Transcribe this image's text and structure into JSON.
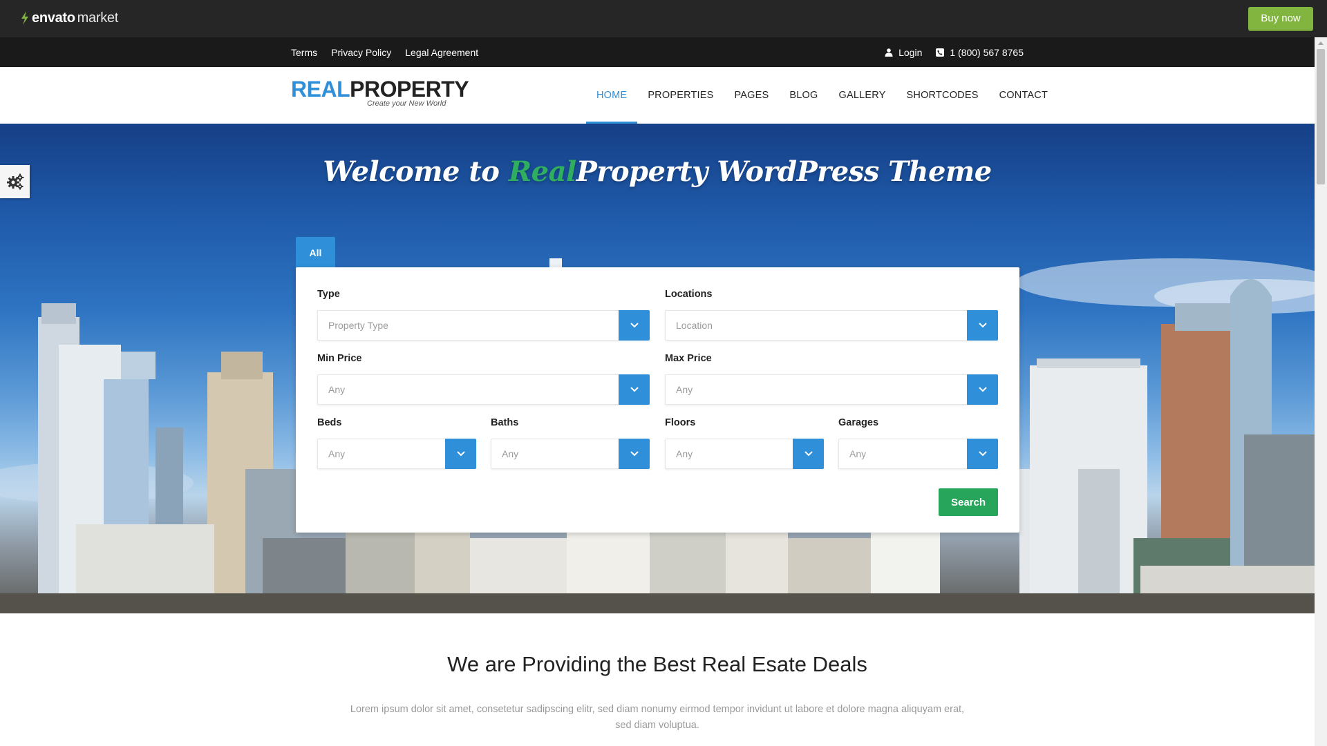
{
  "envato": {
    "brand": "envato",
    "brand_suffix": "market",
    "buy_label": "Buy now",
    "accent": "#82b440"
  },
  "topbar": {
    "links": [
      "Terms",
      "Privacy Policy",
      "Legal Agreement"
    ],
    "login_label": "Login",
    "phone": "1 (800) 567 8765"
  },
  "header": {
    "logo_real": "REAL",
    "logo_property": "PROPERTY",
    "logo_tagline": "Create your New World",
    "nav": [
      "HOME",
      "PROPERTIES",
      "PAGES",
      "BLOG",
      "GALLERY",
      "SHORTCODES",
      "CONTACT"
    ],
    "active_nav": "HOME",
    "accent": "#2f8fd8"
  },
  "hero": {
    "title_pre": "Welcome to ",
    "title_green": "Real",
    "title_post": "Property WordPress Theme"
  },
  "search": {
    "tab_label": "All",
    "type_label": "Type",
    "type_placeholder": "Property Type",
    "locations_label": "Locations",
    "location_placeholder": "Location",
    "min_price_label": "Min Price",
    "min_price_value": "Any",
    "max_price_label": "Max Price",
    "max_price_value": "Any",
    "beds_label": "Beds",
    "beds_value": "Any",
    "baths_label": "Baths",
    "baths_value": "Any",
    "floors_label": "Floors",
    "floors_value": "Any",
    "garages_label": "Garages",
    "garages_value": "Any",
    "search_label": "Search",
    "search_color": "#27a55b"
  },
  "intro": {
    "title": "We are Providing the Best Real Esate Deals",
    "text": "Lorem ipsum dolor sit amet, consetetur sadipscing elitr, sed diam nonumy eirmod tempor invidunt ut labore et dolore magna aliquyam erat, sed diam voluptua."
  },
  "icons": {
    "envato_leaf": "leaf-icon",
    "login": "user-icon",
    "phone": "phone-icon",
    "settings": "gears-icon",
    "select_arrow": "chevron-down-icon"
  }
}
